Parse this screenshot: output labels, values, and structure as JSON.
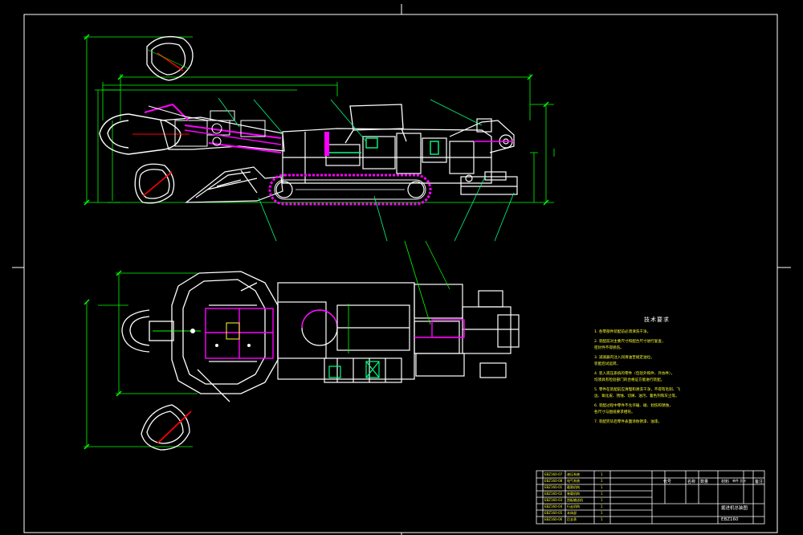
{
  "colors": {
    "background": "#000000",
    "frame": "#ffffff",
    "dimension": "#00ff00",
    "outline": "#ffffff",
    "boom": "#ff00ff",
    "text": "#ffff30",
    "leader": "#00ff80"
  },
  "tech_requirements": {
    "title": "技术要求",
    "items": [
      "1. 各零部件装配前必须清洗干净。",
      "2. 装配前对主要尺寸和配合尺寸进行复查，",
      "   密封件不得损伤。",
      "3. 减速器内注入润滑油至规定油位，",
      "   装配后试运转。",
      "4. 装入液压系统的零件（包括外购件、外协件），",
      "   均须具有检验部门的合格证方能进行装配。",
      "5. 零件在装配前应清理和清洗干净，不得有毛刺、飞",
      "   边、氧化皮、锈蚀、切屑、油污、着色剂和灰尘等。",
      "6. 装配过程中零件不允许磕、碰、划伤和锈蚀，",
      "   各尺寸与图纸要求相符。",
      "7. 装配完毕后零件表面涂防锈漆、油漆。"
    ]
  },
  "title_block": {
    "header_code": "代号",
    "header_name": "名称",
    "header_qty": "数量",
    "header_material": "材料",
    "header_weight": "单件 总计",
    "header_note": "备注",
    "drawing_name": "掘进机总装图",
    "drawing_no": "EBZ160",
    "parts": [
      {
        "code": "EBZ160-01",
        "name": "截割机构",
        "qty": "1"
      },
      {
        "code": "EBZ160-02",
        "name": "装载机构",
        "qty": "1"
      },
      {
        "code": "EBZ160-03",
        "name": "刮板输送机",
        "qty": "1"
      },
      {
        "code": "EBZ160-04",
        "name": "行走机构",
        "qty": "1"
      },
      {
        "code": "EBZ160-05",
        "name": "本体部",
        "qty": "1"
      },
      {
        "code": "EBZ160-06",
        "name": "后支承",
        "qty": "1"
      },
      {
        "code": "EBZ160-07",
        "name": "液压系统",
        "qty": "1"
      },
      {
        "code": "EBZ160-08",
        "name": "电气系统",
        "qty": "1"
      }
    ]
  }
}
